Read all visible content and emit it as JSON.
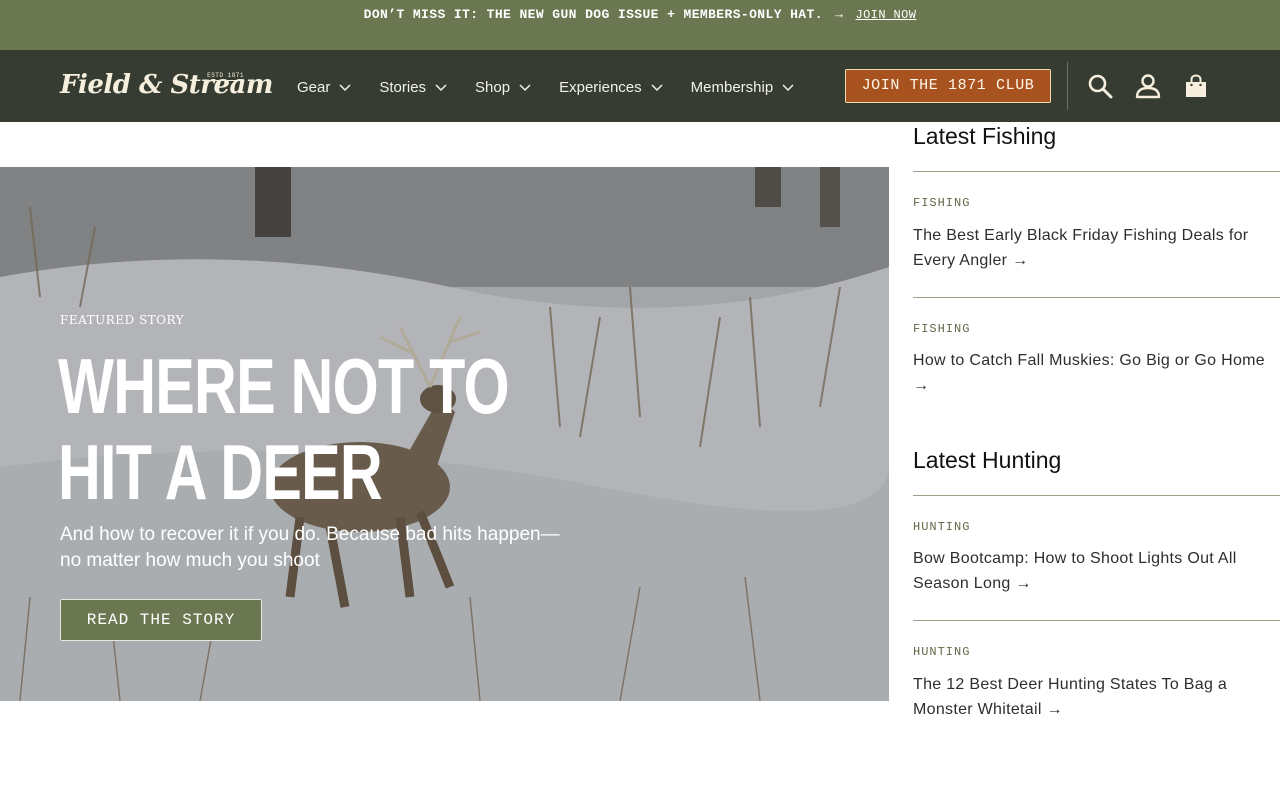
{
  "promo": {
    "text": "DON’T MISS IT: THE NEW GUN DOG ISSUE + MEMBERS-ONLY HAT.",
    "arrow": "→",
    "link_label": "JOIN NOW"
  },
  "header": {
    "logo_text": "Field & Stream",
    "logo_estd": "ESTD 1871",
    "nav": [
      "Gear",
      "Stories",
      "Shop",
      "Experiences",
      "Membership"
    ],
    "join_label": "JOIN THE 1871 CLUB",
    "icons": [
      "search-icon",
      "account-icon",
      "cart-icon"
    ]
  },
  "hero": {
    "eyebrow": "FEATURED STORY",
    "title": "WHERE NOT TO HIT A DEER",
    "subtitle": "And how to recover it if you do. Because bad hits happen—no matter how much you shoot",
    "button_label": "READ THE STORY"
  },
  "sidebar": {
    "fishing_title": "Latest Fishing",
    "hunting_title": "Latest Hunting",
    "fishing": [
      {
        "category": "FISHING",
        "headline": "The Best Early Black Friday Fishing Deals for Every Angler",
        "arrow": "→"
      },
      {
        "category": "FISHING",
        "headline": "How to Catch Fall Muskies: Go Big or Go Home",
        "arrow": "→"
      }
    ],
    "hunting": [
      {
        "category": "HUNTING",
        "headline": "Bow Bootcamp: How to Shoot Lights Out All Season Long",
        "arrow": "→"
      },
      {
        "category": "HUNTING",
        "headline": "The 12 Best Deer Hunting States To Bag a Monster Whitetail",
        "arrow": "→"
      }
    ]
  },
  "colors": {
    "promo_bg": "#6b7750",
    "header_bg": "#363c31",
    "join_button": "#a8531f",
    "read_button": "#6b7750",
    "category_text": "#5f6b47"
  }
}
